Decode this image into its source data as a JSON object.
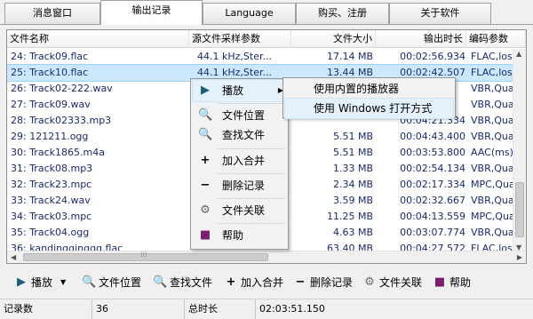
{
  "tabs": [
    "消息窗口",
    "输出记录",
    "Language",
    "购买、注册",
    "关于软件"
  ],
  "columns": [
    "文件名称",
    "源文件采样参数",
    "文件大小",
    "输出时长",
    "编码参数"
  ],
  "rows": [
    {
      "name": "24: Track09.flac",
      "rate": "44.1    kHz,Ster...",
      "size": "17.14 MB",
      "dur": "00:02:56.934",
      "enc": "FLAC,loss"
    },
    {
      "name": "25: Track10.flac",
      "rate": "44.1    kHz,Ster...",
      "size": "13.44 MB",
      "dur": "00:02:42.507",
      "enc": "FLAC,loss"
    },
    {
      "name": "26: Track02-222.wav",
      "rate": "",
      "size": "",
      "dur": "",
      "enc": "VBR,Qual"
    },
    {
      "name": "27: Track09.wav",
      "rate": "",
      "size": "",
      "dur": "",
      "enc": "VBR,Qual"
    },
    {
      "name": "28: Track02333.mp3",
      "rate": "",
      "size": "",
      "dur": "00:04:21.334",
      "enc": "VBR,Qual"
    },
    {
      "name": "29: 121211.ogg",
      "rate": "",
      "size": "5.51 MB",
      "dur": "00:04:43.400",
      "enc": "VBR,Qual"
    },
    {
      "name": "30: Track1865.m4a",
      "rate": "",
      "size": "5.51 MB",
      "dur": "00:03:53.800",
      "enc": "AAC(ms),"
    },
    {
      "name": "31: Track08.mp3",
      "rate": "",
      "size": "1.33 MB",
      "dur": "00:02:54.134",
      "enc": "VBR,Qual"
    },
    {
      "name": "32: Track23.mpc",
      "rate": "",
      "size": "2.34 MB",
      "dur": "00:02:17.334",
      "enc": "MPC,Qual"
    },
    {
      "name": "33: Track24.wav",
      "rate": "",
      "size": "3.59 MB",
      "dur": "00:02:32.667",
      "enc": "VBR,Qual"
    },
    {
      "name": "34: Track03.mpc",
      "rate": "",
      "size": "11.25 MB",
      "dur": "00:04:13.559",
      "enc": "MPC,Qual"
    },
    {
      "name": "35: Track04.ogg",
      "rate": "",
      "size": "4.63 MB",
      "dur": "00:03:07.774",
      "enc": "VBR,Qual"
    },
    {
      "name": "36: kandingginggg.flac",
      "rate": "",
      "size": "63.40 MB",
      "dur": "00:04:27.572",
      "enc": "FLAC,loss"
    }
  ],
  "context_menu": {
    "play": "播放",
    "file_location": "文件位置",
    "find_file": "查找文件",
    "add_merge": "加入合并",
    "delete_record": "删除记录",
    "file_assoc": "文件关联",
    "help": "帮助"
  },
  "submenu": {
    "builtin_player": "使用内置的播放器",
    "windows_open": "使用 Windows 打开方式"
  },
  "toolbar": {
    "play": "播放",
    "file_location": "文件位置",
    "find_file": "查找文件",
    "add_merge": "加入合并",
    "delete_record": "删除记录",
    "file_assoc": "文件关联",
    "help": "帮助"
  },
  "status": {
    "count_label": "记录数",
    "count_value": "36",
    "total_label": "总时长",
    "total_value": "02:03:51.150"
  },
  "colors": {
    "selection": "#cce8ff",
    "row_text": "#1b2a6b",
    "play_icon": "#1f5f7a",
    "help_icon": "#7a1f6e"
  }
}
